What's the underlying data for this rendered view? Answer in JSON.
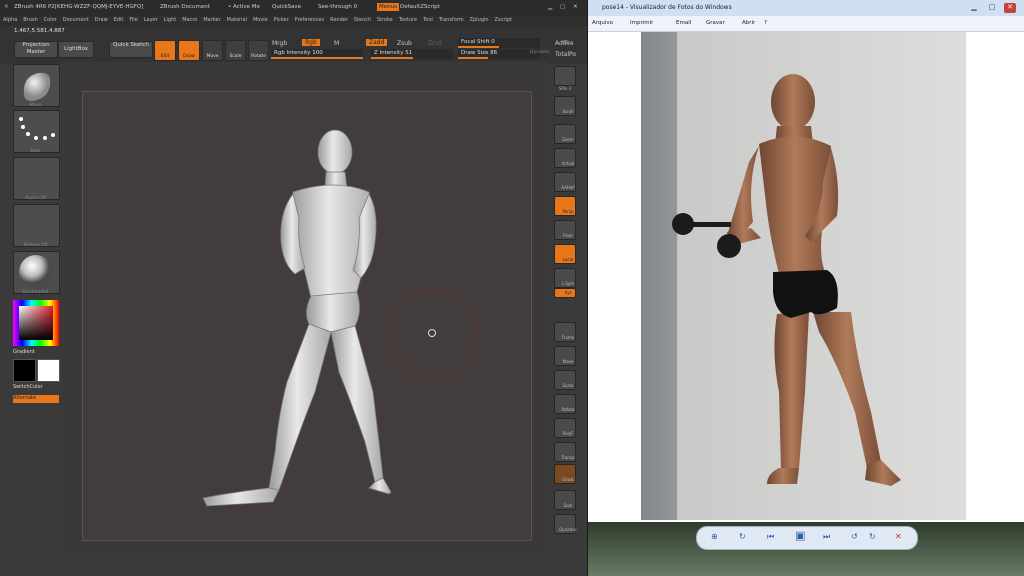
{
  "zbrush": {
    "title_segments": [
      "ZBrush 4R6 P2[KEHG-WZZF-QQMJ-EYVE-HGFQ]",
      "ZBrush Document",
      "• Active Me",
      "QuickSave",
      "See-through 0",
      "Menus",
      "DefaultZScript"
    ],
    "menu_items": [
      "Alpha",
      "Brush",
      "Color",
      "Document",
      "Draw",
      "Edit",
      "File",
      "Layer",
      "Light",
      "Macro",
      "Marker",
      "Material",
      "Movie",
      "Picker",
      "Preferences",
      "Render",
      "Stencil",
      "Stroke",
      "Texture",
      "Tool",
      "Transform",
      "Zplugin",
      "Zscript"
    ],
    "coords": "1.467,5.581,4.887",
    "shelf": {
      "projection_master": "Projection Master",
      "lightbox": "LightBox",
      "quick_sketch": "Quick Sketch",
      "edit": "Edit",
      "draw": "Draw",
      "move": "Move",
      "scale": "Scale",
      "rotate": "Rotate",
      "mrgb": "Mrgb",
      "rgb": "Rgb",
      "m": "M",
      "rgb_intensity": "Rgb Intensity 100",
      "zadd": "Zadd",
      "zsub": "Zsub",
      "zcut": "Zcut",
      "z_intensity": "Z Intensity 51",
      "focal_shift": "Focal Shift 0",
      "draw_size": "Draw Size 86",
      "dynamic": "Dynamic",
      "active": "Active",
      "total": "TotalPo"
    },
    "left": {
      "brush_label": "Move",
      "stroke_label": "Dots",
      "alpha_label": "Alpha Off",
      "texture_label": "Texture Off",
      "material_label": "SkinShade4",
      "gradient": "Gradient",
      "switch_color": "SwitchColor",
      "alternate": "Alternate"
    },
    "right_labels": [
      "BPR",
      "SPix 3",
      "Scroll",
      "Zoom",
      "Actual",
      "AAHalf",
      "Persp",
      "Floor",
      "Local",
      "L.Sym",
      "Xyz",
      "Frame",
      "Move",
      "Scale",
      "Rotate",
      "PolyF",
      "Transp",
      "Ghost",
      "Solo",
      "Dynamic"
    ]
  },
  "photo_viewer": {
    "title": "pose14 - Visualizador de Fotos do Windows",
    "menu": [
      "Arquivo",
      "Imprimir",
      "Email",
      "Gravar",
      "Abrir"
    ],
    "controls": [
      "⊕",
      "↻",
      "⏮",
      "▣",
      "⏭",
      "↺",
      "↻",
      "✕"
    ]
  },
  "colors": {
    "accent": "#e8761a",
    "zbrush_bg": "#3a3a3a",
    "viewer_bg": "#ffffff"
  }
}
